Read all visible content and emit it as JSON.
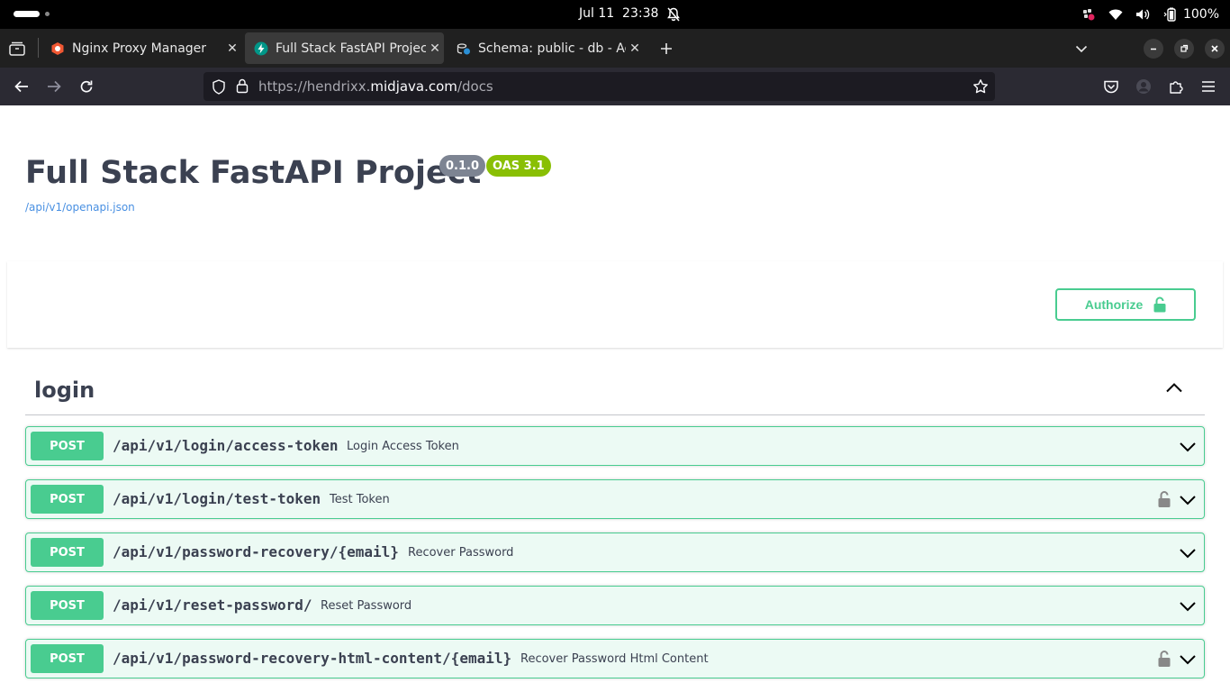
{
  "system_bar": {
    "clock": "Jul 11  23:38",
    "battery": "100%"
  },
  "browser": {
    "tabs": [
      {
        "title": "Nginx Proxy Manager",
        "active": false,
        "icon": "nginx-favicon"
      },
      {
        "title": "Full Stack FastAPI Project",
        "active": true,
        "icon": "fastapi-favicon"
      },
      {
        "title": "Schema: public - db - Adminer",
        "active": false,
        "icon": "adminer-favicon"
      }
    ],
    "url_prefix": "https://hendrixx.",
    "url_host": "midjava.com",
    "url_path": "/docs"
  },
  "page": {
    "title": "Full Stack FastAPI Project",
    "version": "0.1.0",
    "oas": "OAS 3.1",
    "spec_link": "/api/v1/openapi.json",
    "authorize_label": "Authorize",
    "accent_color": "#49cc90",
    "tag": {
      "name": "login",
      "operations": [
        {
          "method": "POST",
          "path": "/api/v1/login/access-token",
          "summary": "Login Access Token",
          "locked": false
        },
        {
          "method": "POST",
          "path": "/api/v1/login/test-token",
          "summary": "Test Token",
          "locked": true
        },
        {
          "method": "POST",
          "path": "/api/v1/password-recovery/{email}",
          "summary": "Recover Password",
          "locked": false
        },
        {
          "method": "POST",
          "path": "/api/v1/reset-password/",
          "summary": "Reset Password",
          "locked": false
        },
        {
          "method": "POST",
          "path": "/api/v1/password-recovery-html-content/{email}",
          "summary": "Recover Password Html Content",
          "locked": true
        }
      ]
    }
  }
}
